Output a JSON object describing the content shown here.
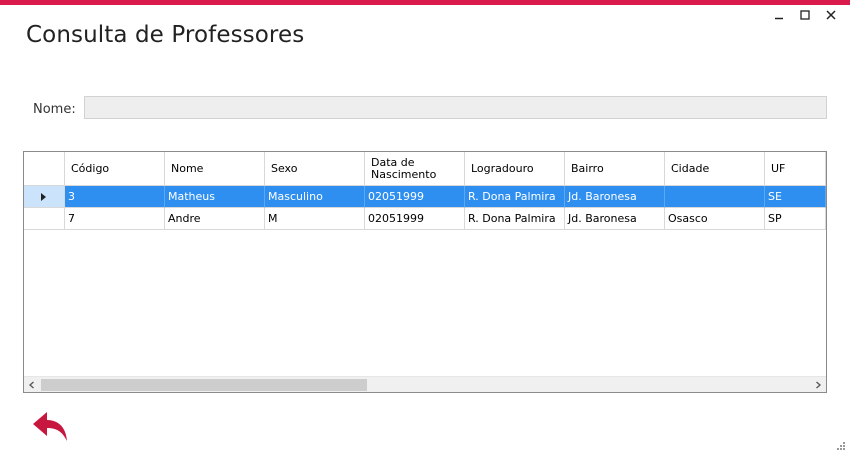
{
  "window": {
    "title": "Consulta de Professores",
    "accent_color": "#d81b4a",
    "controls": [
      "minimize-icon",
      "maximize-icon",
      "close-icon"
    ]
  },
  "search": {
    "label": "Nome:",
    "value": ""
  },
  "grid": {
    "columns": [
      "",
      "Código",
      "Nome",
      "Sexo",
      "Data de Nascimento",
      "Logradouro",
      "Bairro",
      "Cidade",
      "UF"
    ],
    "rows": [
      {
        "Codigo": "3",
        "Nome": "Matheus",
        "Sexo": "Masculino",
        "DataNascimento": "02051999",
        "Logradouro": "R. Dona Palmira",
        "Bairro": "Jd. Baronesa",
        "Cidade": "",
        "UF": "SE",
        "selected": true
      },
      {
        "Codigo": "7",
        "Nome": "Andre",
        "Sexo": "M",
        "DataNascimento": "02051999",
        "Logradouro": "R. Dona Palmira",
        "Bairro": "Jd. Baronesa",
        "Cidade": "Osasco",
        "UF": "SP",
        "selected": false
      }
    ],
    "selection_color": "#2e8ff0",
    "row_indicator": "row-pointer-icon"
  },
  "footer": {
    "back_icon": "back-arrow-icon",
    "back_color": "#c8173f"
  }
}
